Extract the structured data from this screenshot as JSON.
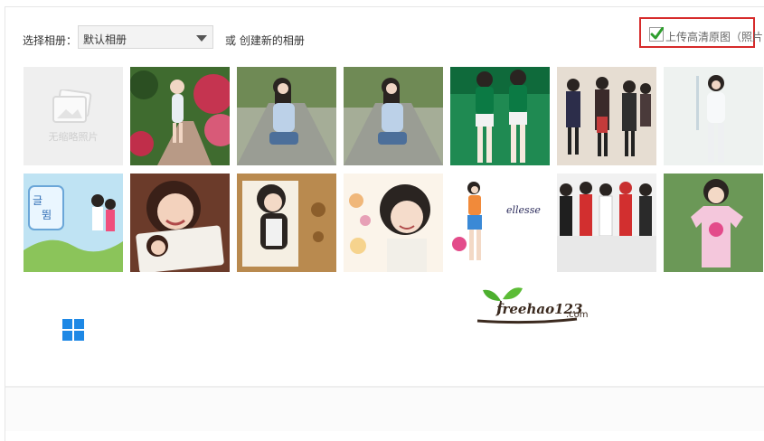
{
  "album": {
    "label": "选择相册：",
    "selected": "默认相册",
    "create_text": "或 创建新的相册"
  },
  "upload_hd": {
    "checked": true,
    "label": "上传高清原图（照片"
  },
  "empty_album": {
    "caption": "无缩略照片"
  },
  "photos": [
    {
      "icon": "photo-girl-garden-path"
    },
    {
      "icon": "photo-girl-on-road"
    },
    {
      "icon": "photo-girl-on-road-copy"
    },
    {
      "icon": "photo-girls-green-uniform"
    },
    {
      "icon": "photo-group-winter-coats"
    },
    {
      "icon": "photo-girl-white-outfit"
    },
    {
      "icon": "photo-cartoon-illustration"
    },
    {
      "icon": "photo-girl-smiling-portrait"
    },
    {
      "icon": "photo-girl-vintage-background"
    },
    {
      "icon": "photo-girl-floral-portrait"
    },
    {
      "icon": "photo-girl-ellesse-ad"
    },
    {
      "icon": "photo-group-red-scarves"
    },
    {
      "icon": "photo-girl-pink-tshirt"
    }
  ],
  "watermark": {
    "text": "freehao123",
    "suffix": ".com"
  },
  "colors": {
    "highlight_border": "#d62b2b",
    "check_green": "#2e9e2e",
    "windows_blue": "#1e88e5"
  }
}
